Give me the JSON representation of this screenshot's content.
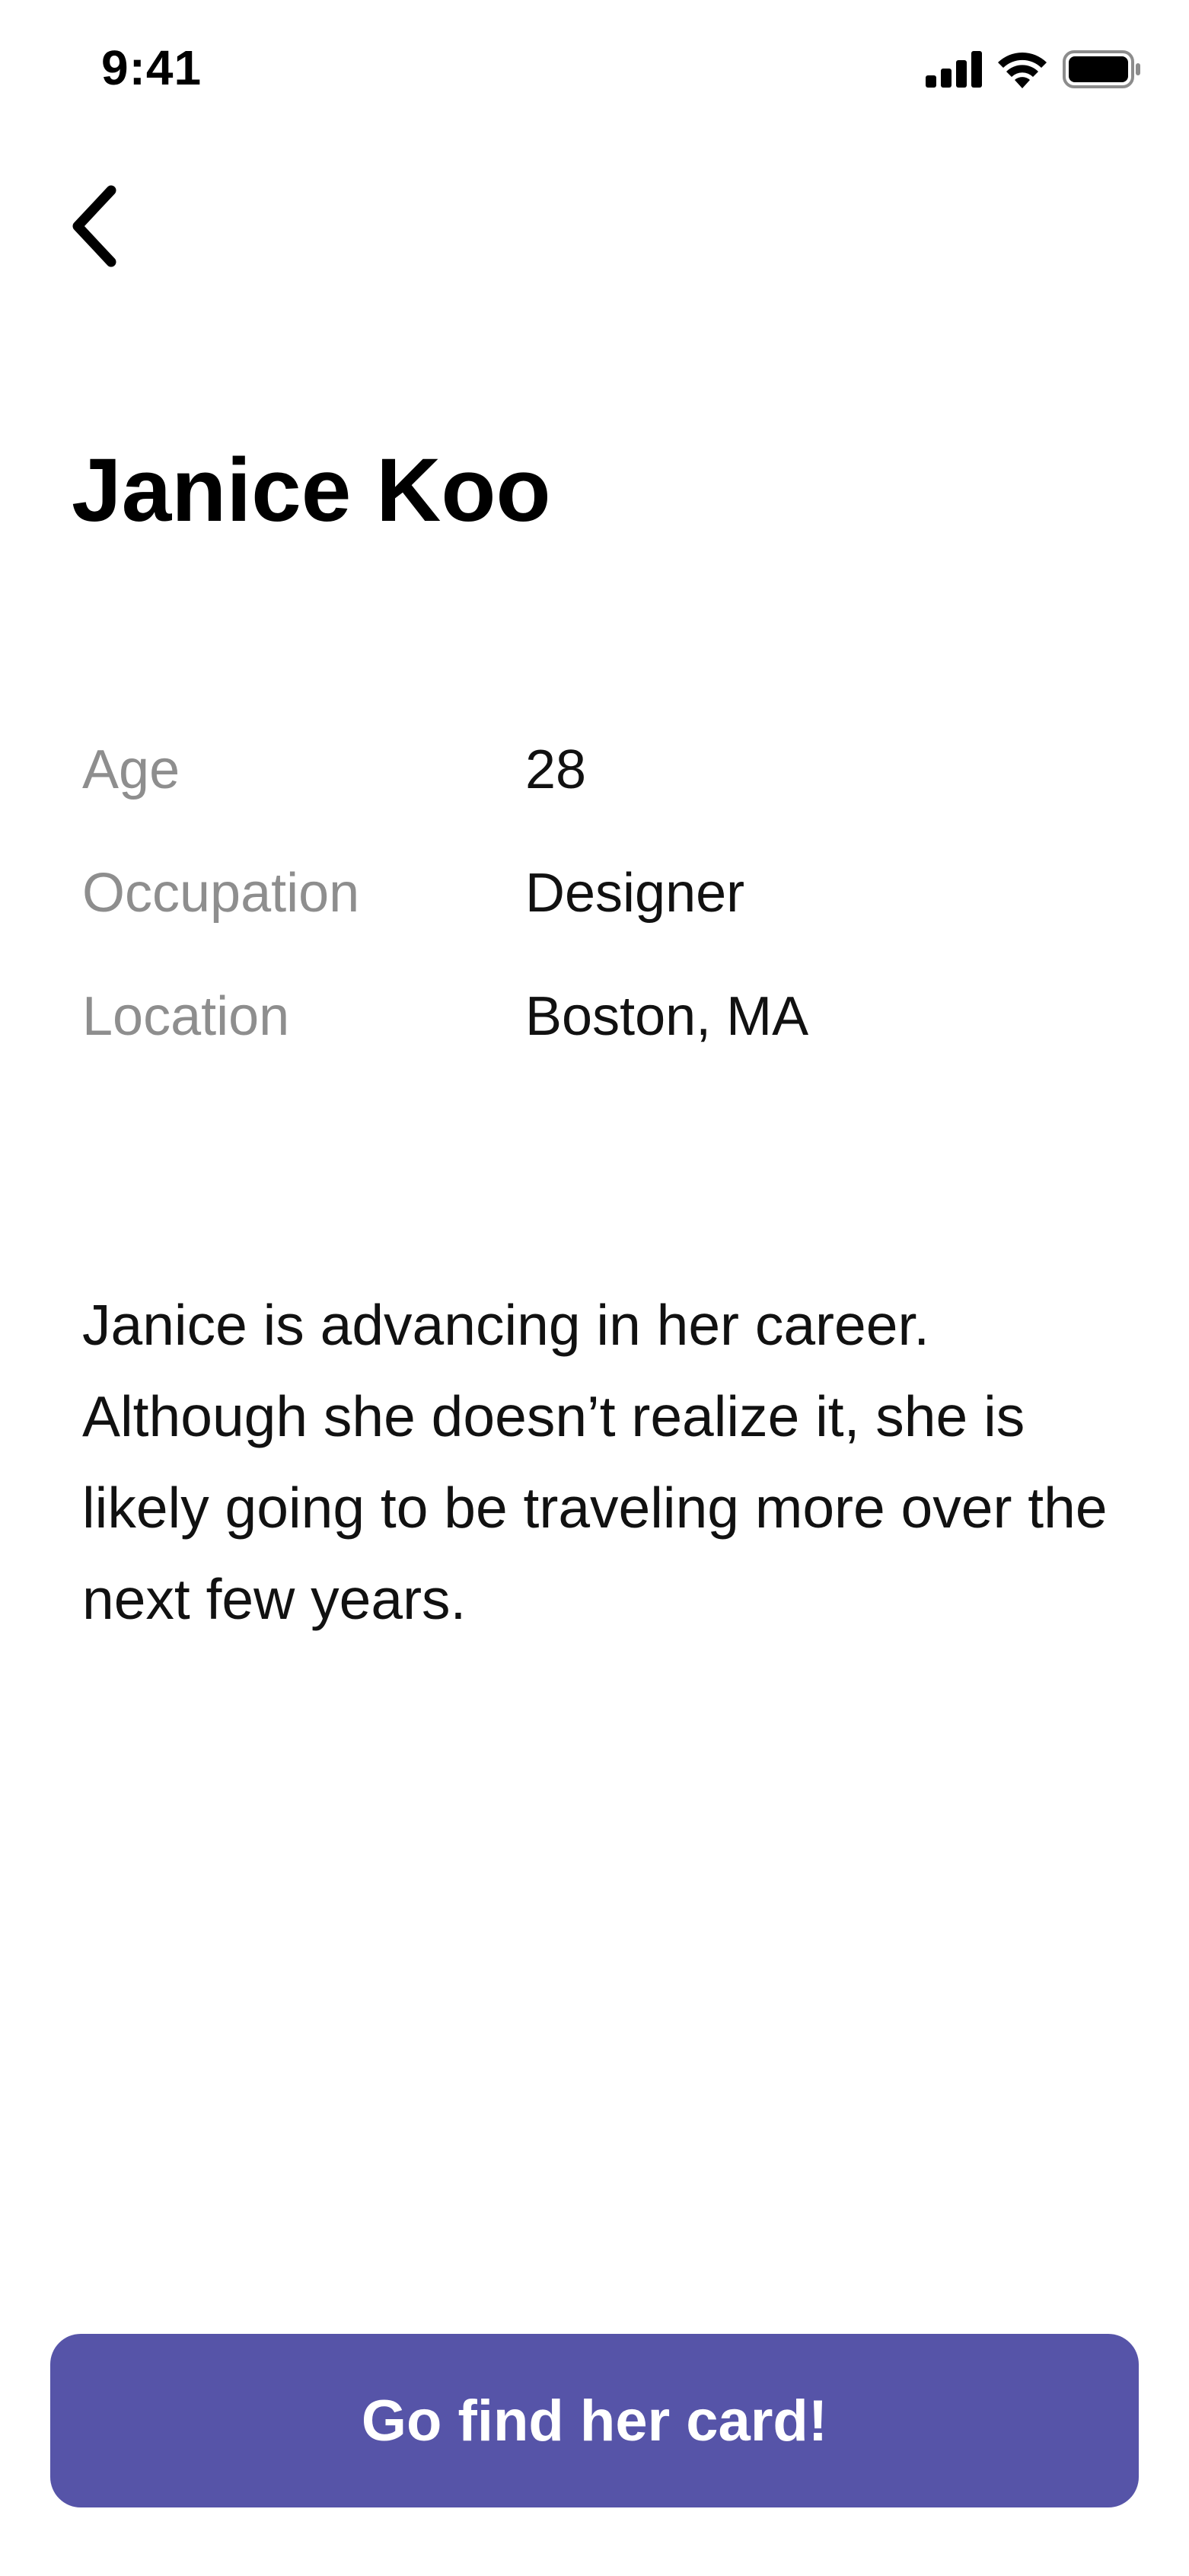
{
  "status_bar": {
    "time": "9:41",
    "icons": [
      "signal-icon",
      "wifi-icon",
      "battery-icon"
    ]
  },
  "nav": {
    "back_icon": "chevron-left-icon"
  },
  "profile": {
    "name": "Janice Koo",
    "details": [
      {
        "label": "Age",
        "value": "28"
      },
      {
        "label": "Occupation",
        "value": "Designer"
      },
      {
        "label": "Location",
        "value": "Boston, MA"
      }
    ],
    "bio": "Janice is advancing in her career. Although she doesn’t realize it, she is likely going to be traveling more over the next few years."
  },
  "cta": {
    "label": "Go find her card!"
  },
  "colors": {
    "accent": "#5654a8",
    "label_gray": "#8e8e8e",
    "text": "#111111",
    "background": "#ffffff"
  }
}
